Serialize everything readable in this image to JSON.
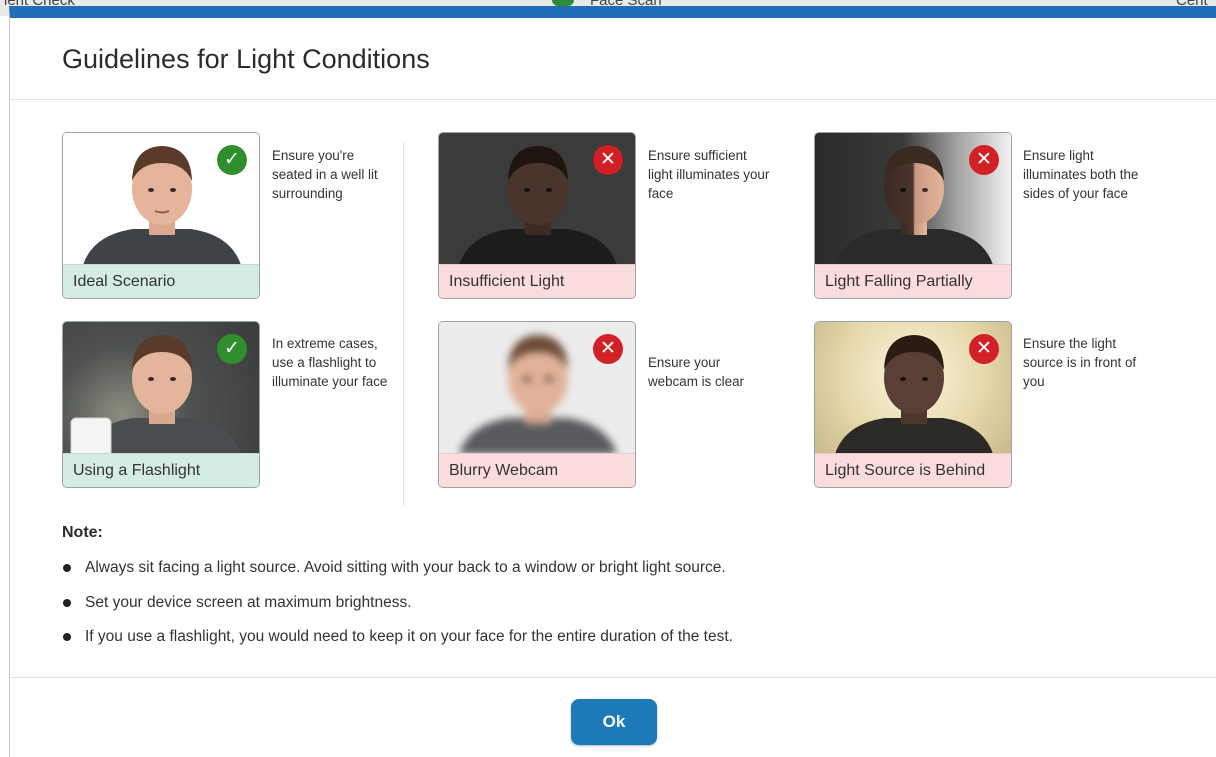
{
  "background": {
    "left_text": "ient Check",
    "center_text": "Face Scan",
    "right_text": "Cent"
  },
  "dialog": {
    "title": "Guidelines for Light Conditions"
  },
  "cards": [
    {
      "label": "Ideal Scenario",
      "status": "good",
      "icon": "check-icon",
      "description": "Ensure you're seated in a well lit surrounding"
    },
    {
      "label": "Insufficient Light",
      "status": "bad",
      "icon": "close-icon",
      "description": "Ensure sufficient light illuminates your face"
    },
    {
      "label": "Light Falling Partially",
      "status": "bad",
      "icon": "close-icon",
      "description": "Ensure light illuminates both the sides of your face"
    },
    {
      "label": "Using a Flashlight",
      "status": "good",
      "icon": "check-icon",
      "description": "In extreme cases, use a flashlight to illuminate your face"
    },
    {
      "label": "Blurry Webcam",
      "status": "bad",
      "icon": "close-icon",
      "description": "Ensure your webcam is clear"
    },
    {
      "label": "Light Source is Behind",
      "status": "bad",
      "icon": "close-icon",
      "description": "Ensure the light source is in front of you"
    }
  ],
  "icons": {
    "check": "✓",
    "close": "✕"
  },
  "note": {
    "title": "Note:",
    "items": [
      "Always sit facing a light source. Avoid sitting with your back to a window or bright light source.",
      "Set your device screen at maximum brightness.",
      "If you use a flashlight, you would need to keep it on your face for the entire duration of the test."
    ]
  },
  "footer": {
    "ok_label": "Ok"
  },
  "colors": {
    "accent": "#1f6fb8",
    "button": "#1d79b8",
    "good_caption": "#d5ece2",
    "bad_caption": "#fbdcdc",
    "good_badge": "#2f8f2f",
    "bad_badge": "#d22027"
  }
}
